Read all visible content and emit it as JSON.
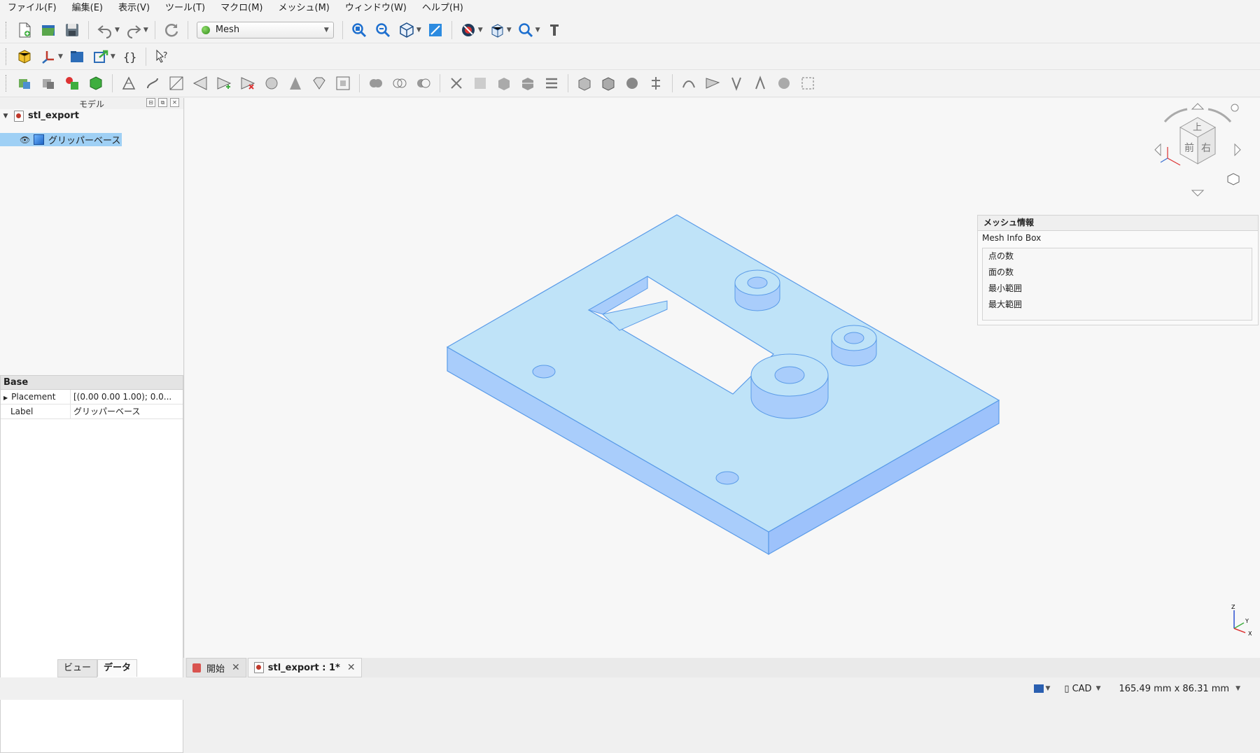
{
  "menubar": {
    "items": [
      "ファイル(F)",
      "編集(E)",
      "表示(V)",
      "ツール(T)",
      "マクロ(M)",
      "メッシュ(M)",
      "ウィンドウ(W)",
      "ヘルプ(H)"
    ]
  },
  "toolbar": {
    "workbench": "Mesh",
    "icons_row1": [
      "new-file-icon",
      "open-file-icon",
      "save-icon",
      "undo-icon",
      "redo-icon",
      "refresh-icon",
      "fit-all-icon",
      "fit-selection-icon",
      "isometric-view-icon",
      "measure-icon",
      "draw-style-icon",
      "std-views-icon",
      "zoom-icon",
      "tool-icon"
    ],
    "icons_row2": [
      "part-icon",
      "axis-icon",
      "folder-icon",
      "export-icon",
      "macro-braces-icon",
      "whats-this-icon"
    ]
  },
  "model_panel": {
    "title": "モデル",
    "document": "stl_export",
    "object": "グリッパーベース"
  },
  "properties": {
    "group": "Base",
    "rows": [
      {
        "key": "Placement",
        "value": "[(0.00 0.00 1.00); 0.0..."
      },
      {
        "key": "Label",
        "value": "グリッパーベース"
      }
    ]
  },
  "left_tabs": [
    "ビュー",
    "データ"
  ],
  "mesh_info": {
    "title": "メッシュ情報",
    "subtitle": "Mesh Info Box",
    "rows": [
      "点の数",
      "面の数",
      "最小範囲",
      "最大範囲"
    ]
  },
  "navcube": {
    "top": "上",
    "front": "前",
    "right": "右"
  },
  "axis": {
    "z": "Z",
    "y": "Y",
    "x": "X"
  },
  "doc_tabs": [
    {
      "label": "開始"
    },
    {
      "label": "stl_export : 1*"
    }
  ],
  "status": {
    "nav_style": "CAD",
    "dimensions": "165.49 mm x 86.31 mm"
  },
  "colors": {
    "mesh_fill": "#bfe3f8",
    "mesh_side": "#9dc2fb",
    "mesh_edge": "#5a9be8",
    "selection": "#9fd0f5"
  }
}
